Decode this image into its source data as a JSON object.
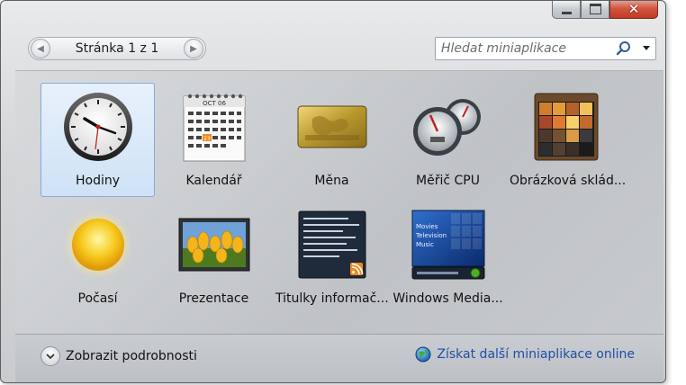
{
  "window": {
    "buttons": {
      "minimize": "minimize",
      "maximize": "maximize",
      "close": "close"
    }
  },
  "pager": {
    "label": "Stránka 1 z 1"
  },
  "search": {
    "placeholder": "Hledat miniaplikace"
  },
  "gadgets": [
    {
      "label": "Hodiny",
      "icon": "clock-icon",
      "selected": true
    },
    {
      "label": "Kalendář",
      "icon": "calendar-icon",
      "calendar_month": "OCT 06",
      "highlighted_day": "23"
    },
    {
      "label": "Měna",
      "icon": "currency-card-icon"
    },
    {
      "label": "Měřič CPU",
      "icon": "cpu-meter-icon"
    },
    {
      "label": "Obrázková sklád...",
      "icon": "picture-puzzle-icon"
    },
    {
      "label": "Počasí",
      "icon": "weather-sun-icon"
    },
    {
      "label": "Prezentace",
      "icon": "slideshow-icon"
    },
    {
      "label": "Titulky informač...",
      "icon": "feed-headlines-icon"
    },
    {
      "label": "Windows Media...",
      "icon": "media-center-icon",
      "menu": [
        "Movies",
        "Television",
        "Music"
      ]
    }
  ],
  "footer": {
    "details_label": "Zobrazit podrobnosti",
    "online_label": "Získat další miniaplikace online"
  },
  "colors": {
    "link": "#1f4fa8",
    "selection_border": "#84acd8",
    "close_button": "#c03a22"
  }
}
